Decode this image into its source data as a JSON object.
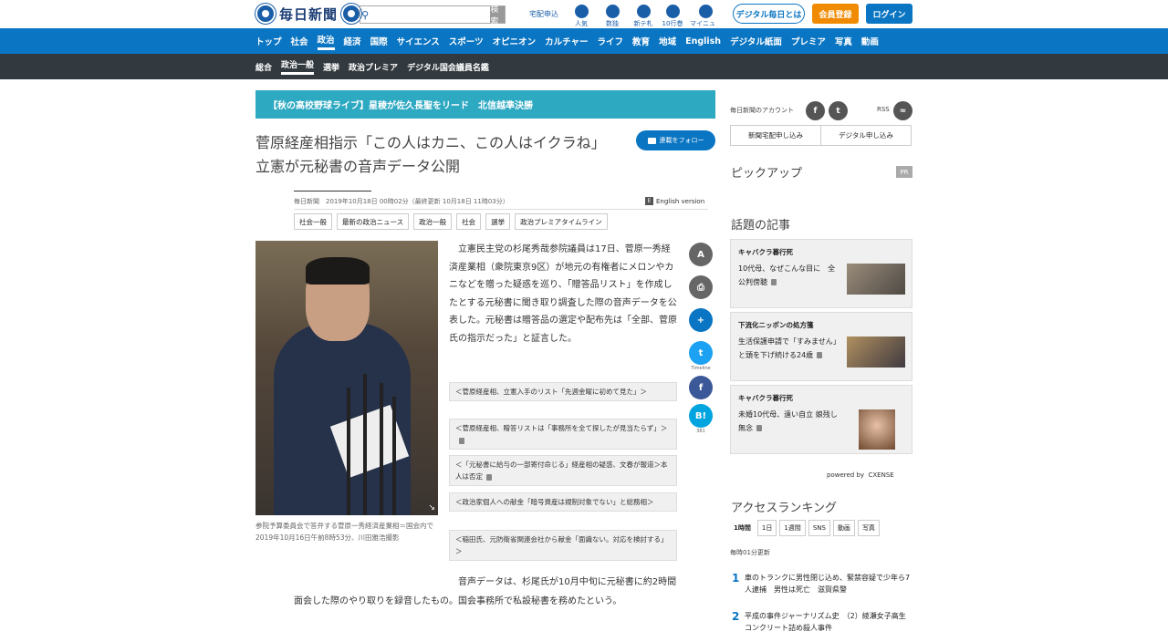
{
  "header": {
    "logo_text": "毎日新聞",
    "search_placeholder": "",
    "search_button": "検索",
    "delivery_link": "宅配申込",
    "tools": [
      {
        "label": "人気",
        "icon": "ranking-icon"
      },
      {
        "label": "数独",
        "icon": "sudoku-icon"
      },
      {
        "label": "新テ札",
        "icon": "news-icon"
      },
      {
        "label": "10行巻",
        "icon": "digest-icon"
      },
      {
        "label": "マイニュース",
        "icon": "mynews-icon"
      }
    ],
    "about_digital": "デジタル毎日とは",
    "register": "会員登録",
    "login": "ログイン",
    "colors": {
      "brand": "#0a75c2",
      "register": "#f08a00",
      "subnav": "#333a3f"
    }
  },
  "nav_main": [
    "トップ",
    "社会",
    "政治",
    "経済",
    "国際",
    "サイエンス",
    "スポーツ",
    "オピニオン",
    "カルチャー",
    "ライフ",
    "教育",
    "地域",
    "English",
    "デジタル紙面",
    "プレミア",
    "写真",
    "動画"
  ],
  "nav_main_active": "政治",
  "nav_sub": [
    "総合",
    "政治一般",
    "選挙",
    "政治プレミア",
    "デジタル国会議員名鑑"
  ],
  "nav_sub_active": "政治一般",
  "banner": "【秋の高校野球ライブ】星稜が佐久長聖をリード　北信越準決勝",
  "article": {
    "title": "菅原経産相指示「この人はカニ、この人はイクラね」　立憲が元秘書の音声データ公開",
    "follow_button": "連載をフォロー",
    "meta": "毎日新聞　2019年10月18日 00時02分（最終更新 10月18日 11時03分）",
    "english_version": "English version",
    "tags": [
      "社会一般",
      "最新の政治ニュース",
      "政治一般",
      "社会",
      "選挙",
      "政治プレミアタイムライン"
    ],
    "photo_caption": "参院予算委員会で答弁する菅原一秀経済産業相＝国会内で2019年10月16日午前8時53分、川田雅浩撮影",
    "lead": "立憲民主党の杉尾秀哉参院議員は17日、菅原一秀経済産業相（衆院東京9区）が地元の有権者にメロンやカニなどを贈った疑惑を巡り、「贈答品リスト」を作成したとする元秘書に聞き取り調査した際の音声データを公表した。元秘書は贈答品の選定や配布先は「全部、菅原氏の指示だった」と証言した。",
    "related": [
      "＜菅原経産相、立憲入手のリスト「先週金曜に初めて見た」＞",
      "＜菅原経産相、贈答リストは「事務所を全て探したが見当たらず」＞",
      "＜「元秘書に給与の一部寄付命じる」経産相の疑惑、文春が報道＞本人は否定",
      "＜政治家個人への献金「暗号資産は規制対象でない」と総務相＞",
      "＜稲田氏、元防衛省関連会社から献金「面識ない。対応を検討する」＞"
    ],
    "related_locked": [
      false,
      true,
      true,
      false,
      false
    ],
    "body2": "音声データは、杉尾氏が10月中旬に元秘書に約2時間面会した際のやり取りを録音したもの。国会事務所で私設秘書を務めたという。"
  },
  "share": {
    "items": [
      "font-size-icon",
      "print-icon",
      "follow-icon",
      "twitter-icon",
      "facebook-icon",
      "hatena-icon"
    ],
    "twitter_label": "Timeline",
    "hatena_count": "381"
  },
  "sidebar": {
    "account_label": "毎日新聞のアカウント",
    "rss_label": "RSS",
    "subscribe_paper": "新聞宅配申し込み",
    "subscribe_digital": "デジタル申し込み",
    "pickup_heading": "ピックアップ",
    "pr_badge": "PR",
    "topic_heading": "話題の記事",
    "topics": [
      {
        "category": "キャバクラ暮行死",
        "text": "10代母、なぜこんな目に　全公判傍聴"
      },
      {
        "category": "下流化ニッポンの処方箋",
        "text": "生活保護申請で「すみません」と頭を下げ続ける24歳"
      },
      {
        "category": "キャバクラ暮行死",
        "text": "未婚10代母、遠い自立 娘残し無念"
      }
    ],
    "powered_by": "powered by",
    "cxense": "CXENSE",
    "ranking_heading": "アクセスランキング",
    "ranking_tabs": [
      "1時間",
      "1日",
      "1週間",
      "SNS",
      "動画",
      "写真"
    ],
    "ranking_updated": "毎時01分更新",
    "ranking": [
      {
        "rank": "1",
        "text": "車のトランクに男性閉じ込め、緊禁容疑で少年ら7人逮捕　男性は死亡　滋賀県警"
      },
      {
        "rank": "2",
        "text": "平成の事件ジャーナリズム史　（2）綾瀬女子高生コンクリート詰め殺人事件"
      }
    ]
  }
}
